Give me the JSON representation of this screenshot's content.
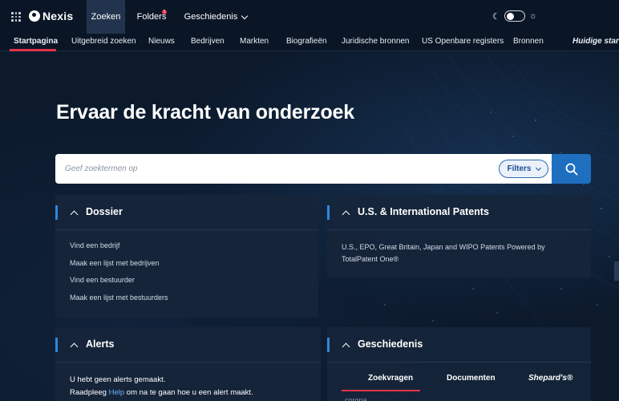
{
  "app": {
    "brand": "Nexis"
  },
  "topnav": {
    "zoeken": "Zoeken",
    "folders": "Folders",
    "folders_badge": "1",
    "geschiedenis": "Geschiedenis"
  },
  "subnav": {
    "items": [
      "Startpagina",
      "Uitgebreid zoeken",
      "Nieuws",
      "Bedrijven",
      "Markten",
      "Biografieën",
      "Juridische bronnen",
      "US Openbare registers",
      "Bronnen",
      "Huidige startpa"
    ]
  },
  "hero": {
    "title": "Ervaar de kracht van onderzoek"
  },
  "search": {
    "placeholder": "Geef zoektermen op",
    "filters_label": "Filters"
  },
  "cards": {
    "dossier": {
      "title": "Dossier",
      "links": [
        "Vind een bedrijf",
        "Maak een lijst met bedrijven",
        "Vind een bestuurder",
        "Maak een lijst met bestuurders"
      ]
    },
    "patents": {
      "title": "U.S. & International Patents",
      "text": "U.S., EPO, Great Britain, Japan and WIPO Patents Powered by TotalPatent One®"
    },
    "alerts": {
      "title": "Alerts",
      "line1": "U hebt geen alerts gemaakt.",
      "line2_pre": "Raadpleeg ",
      "line2_link": "Help",
      "line2_post": " om na te gaan hoe u een alert maakt."
    },
    "history": {
      "title": "Geschiedenis",
      "tabs": [
        "Zoekvragen",
        "Documenten",
        "Shepard's®"
      ],
      "first_item": "corona"
    }
  },
  "colors": {
    "accent": "#1f6fc1",
    "active_underline": "#e4334b",
    "background": "#0c1a2c"
  }
}
